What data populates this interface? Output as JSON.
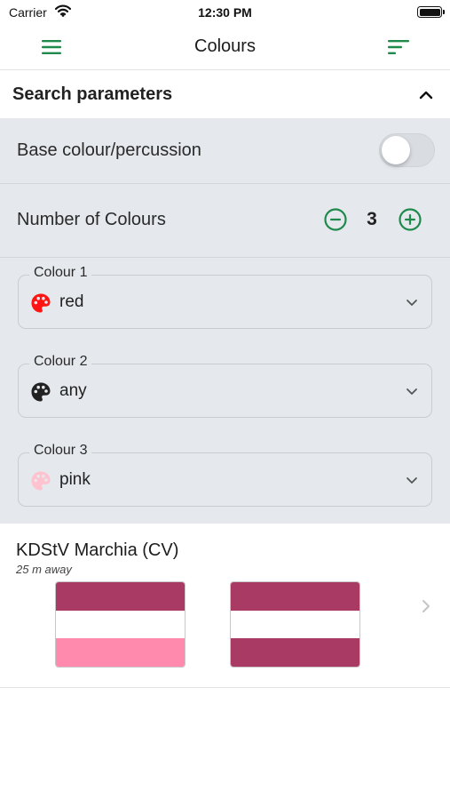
{
  "status_bar": {
    "carrier": "Carrier",
    "time": "12:30 PM"
  },
  "navbar": {
    "title": "Colours",
    "accent_color": "#1f8a4c",
    "left_icon": "hamburger-menu-icon",
    "right_icon": "sort-filter-icon"
  },
  "search_parameters": {
    "title": "Search parameters",
    "expanded": true,
    "base_colour": {
      "label": "Base colour/percussion",
      "enabled": false
    },
    "number_of_colours": {
      "label": "Number of Colours",
      "value": "3"
    },
    "colours": [
      {
        "label": "Colour 1",
        "value": "red",
        "swatch": "#ff1414"
      },
      {
        "label": "Colour 2",
        "value": "any",
        "swatch": "#222222"
      },
      {
        "label": "Colour 3",
        "value": "pink",
        "swatch": "#ffc2cf"
      }
    ]
  },
  "results": [
    {
      "name": "KDStV Marchia (CV)",
      "distance": "25 m away",
      "flags": [
        {
          "stripes": [
            "#a83a63",
            "#ffffff",
            "#ff8aae"
          ]
        },
        {
          "stripes": [
            "#a83a63",
            "#ffffff",
            "#a83a63"
          ]
        }
      ]
    }
  ]
}
